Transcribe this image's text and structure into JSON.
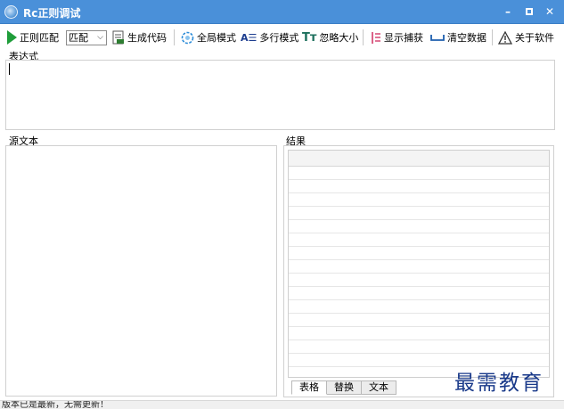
{
  "window": {
    "title": "Rc正则调试",
    "minimize_glyph": "–",
    "close_glyph": "✕"
  },
  "toolbar": {
    "regex_match": "正则匹配",
    "match_select_value": "匹配",
    "generate_code": "生成代码",
    "global_mode": "全局模式",
    "multiline_mode": "多行模式",
    "ignore_case": "忽略大小",
    "show_capture": "显示捕获",
    "clear_data": "清空数据",
    "about": "关于软件",
    "multiline_icon_glyph": "A☰",
    "ignore_case_icon_glyph": "Tт"
  },
  "panels": {
    "expression_label": "表达式",
    "source_label": "源文本",
    "result_label": "结果"
  },
  "result_tabs": [
    "表格",
    "替换",
    "文本"
  ],
  "status": {
    "text": "版本已是最新，无需更新！"
  },
  "watermark": {
    "text": "最需教育"
  },
  "colors": {
    "titlebar": "#4a90d9",
    "play_green": "#1f9d3a",
    "watermark": "#1a3a8a"
  },
  "icons": {
    "app": "app-logo-icon",
    "regex_match": "play-icon",
    "generate_code": "document-code-icon",
    "global_mode": "globe-icon",
    "multiline_mode": "multiline-text-icon",
    "ignore_case": "text-case-icon",
    "show_capture": "capture-list-icon",
    "clear_data": "clear-icon",
    "about": "warning-triangle-icon"
  }
}
